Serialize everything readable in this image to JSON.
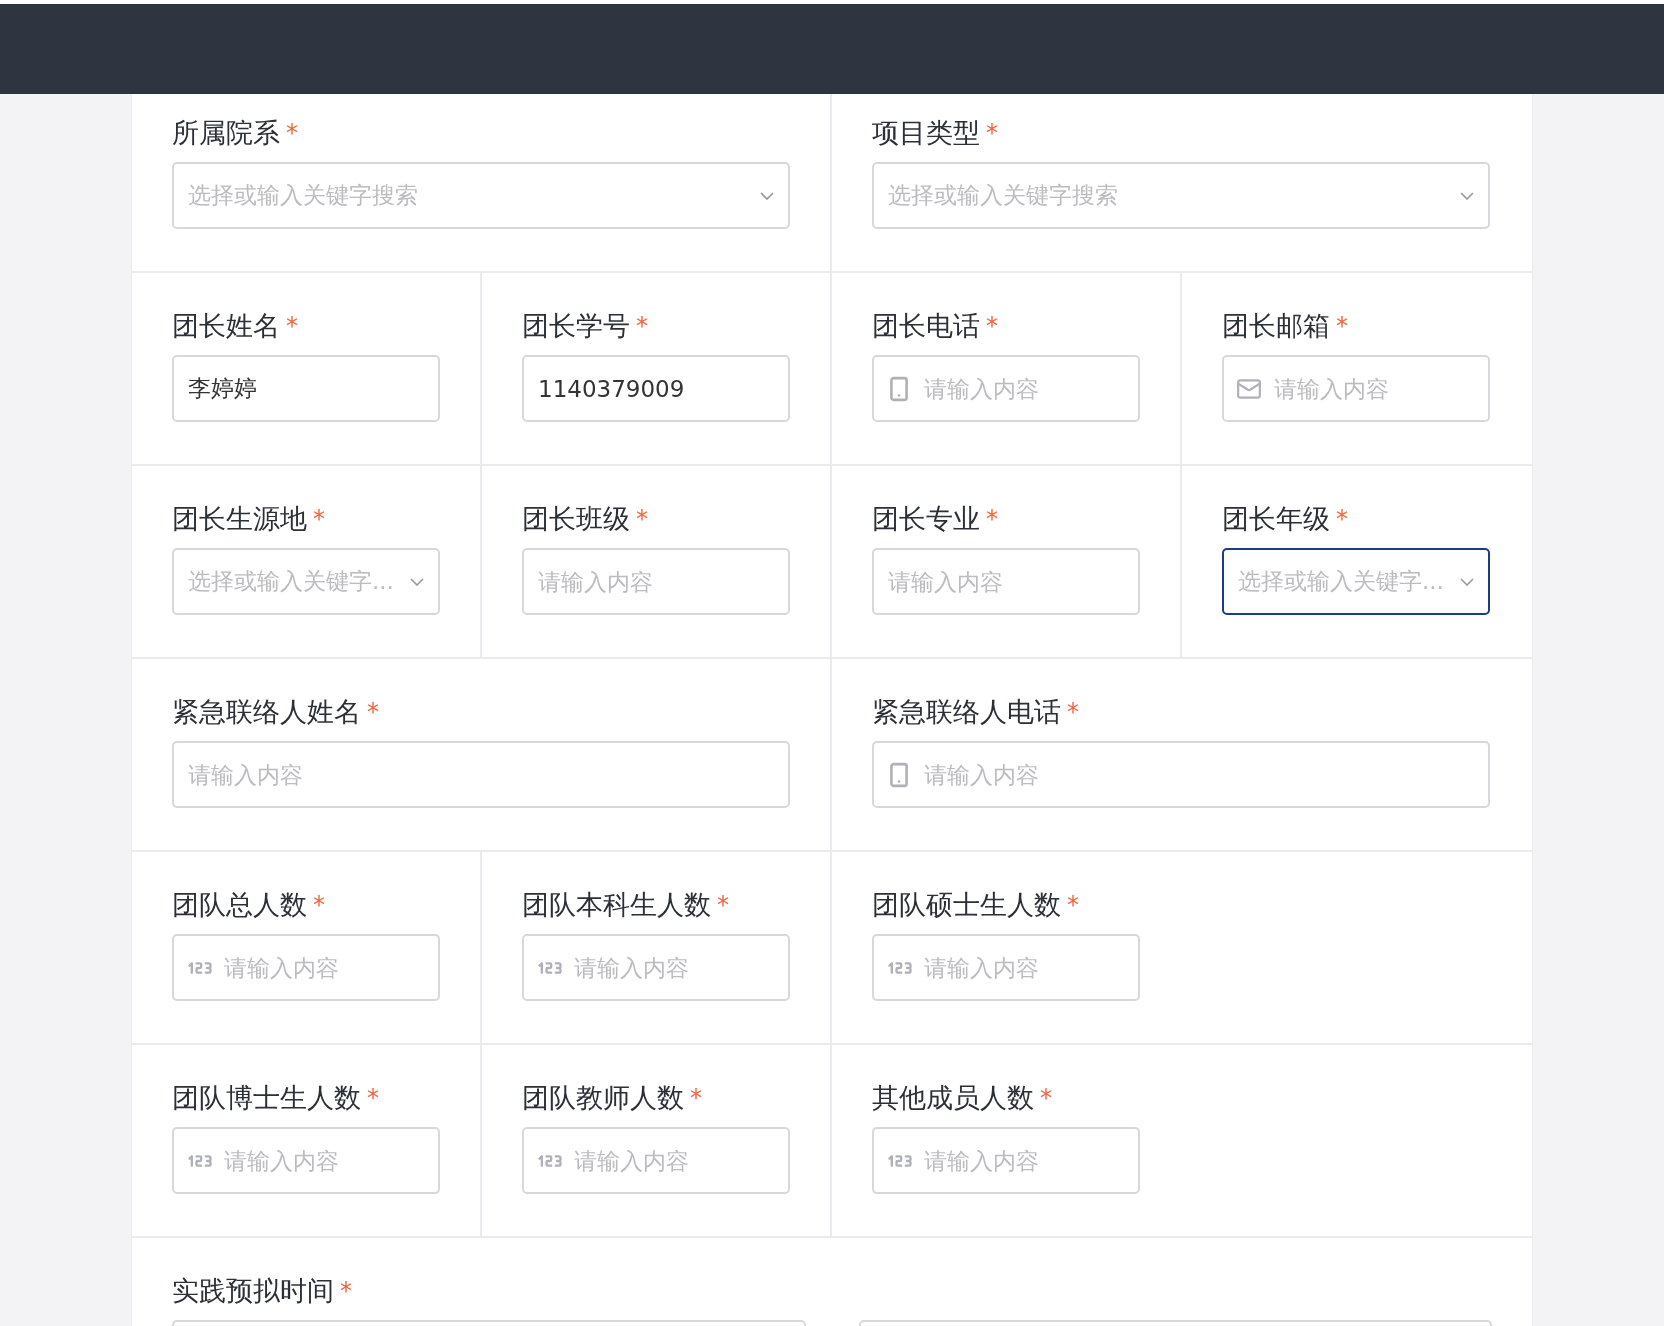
{
  "rows": [
    {
      "fields": [
        {
          "label": "所属院系",
          "required_mark": "*",
          "kind": "select",
          "placeholder": "选择或输入关键字搜索",
          "focused": false
        },
        {
          "label": "项目类型",
          "required_mark": "*",
          "kind": "select",
          "placeholder": "选择或输入关键字搜索",
          "focused": false
        }
      ]
    },
    {
      "fields": [
        {
          "label": "团长姓名",
          "required_mark": "*",
          "kind": "text",
          "value": "李婷婷",
          "focused": false
        },
        {
          "label": "团长学号",
          "required_mark": "*",
          "kind": "text",
          "value": "1140379009",
          "focused": false
        },
        {
          "label": "团长电话",
          "required_mark": "*",
          "kind": "phone",
          "placeholder": "请输入内容",
          "focused": false
        },
        {
          "label": "团长邮箱",
          "required_mark": "*",
          "kind": "email",
          "placeholder": "请输入内容",
          "focused": false
        }
      ]
    },
    {
      "fields": [
        {
          "label": "团长生源地",
          "required_mark": "*",
          "kind": "select",
          "placeholder": "选择或输入关键字...",
          "focused": false
        },
        {
          "label": "团长班级",
          "required_mark": "*",
          "kind": "text",
          "placeholder": "请输入内容",
          "focused": false
        },
        {
          "label": "团长专业",
          "required_mark": "*",
          "kind": "text",
          "placeholder": "请输入内容",
          "focused": false
        },
        {
          "label": "团长年级",
          "required_mark": "*",
          "kind": "select",
          "placeholder": "选择或输入关键字...",
          "focused": true
        }
      ]
    },
    {
      "fields": [
        {
          "label": "紧急联络人姓名",
          "required_mark": "*",
          "kind": "text",
          "placeholder": "请输入内容",
          "focused": false
        },
        {
          "label": "紧急联络人电话",
          "required_mark": "*",
          "kind": "phone",
          "placeholder": "请输入内容",
          "focused": false
        }
      ]
    },
    {
      "fields": [
        {
          "label": "团队总人数",
          "required_mark": "*",
          "kind": "number",
          "placeholder": "请输入内容",
          "focused": false
        },
        {
          "label": "团队本科生人数",
          "required_mark": "*",
          "kind": "number",
          "placeholder": "请输入内容",
          "focused": false
        },
        {
          "label": "团队硕士生人数",
          "required_mark": "*",
          "kind": "number",
          "placeholder": "请输入内容",
          "focused": false
        }
      ]
    },
    {
      "fields": [
        {
          "label": "团队博士生人数",
          "required_mark": "*",
          "kind": "number",
          "placeholder": "请输入内容",
          "focused": false
        },
        {
          "label": "团队教师人数",
          "required_mark": "*",
          "kind": "number",
          "placeholder": "请输入内容",
          "focused": false
        },
        {
          "label": "其他成员人数",
          "required_mark": "*",
          "kind": "number",
          "placeholder": "请输入内容",
          "focused": false
        }
      ]
    },
    {
      "fields": [
        {
          "label": "实践预拟时间",
          "required_mark": "*",
          "kind": "range",
          "focused": false
        }
      ]
    }
  ]
}
